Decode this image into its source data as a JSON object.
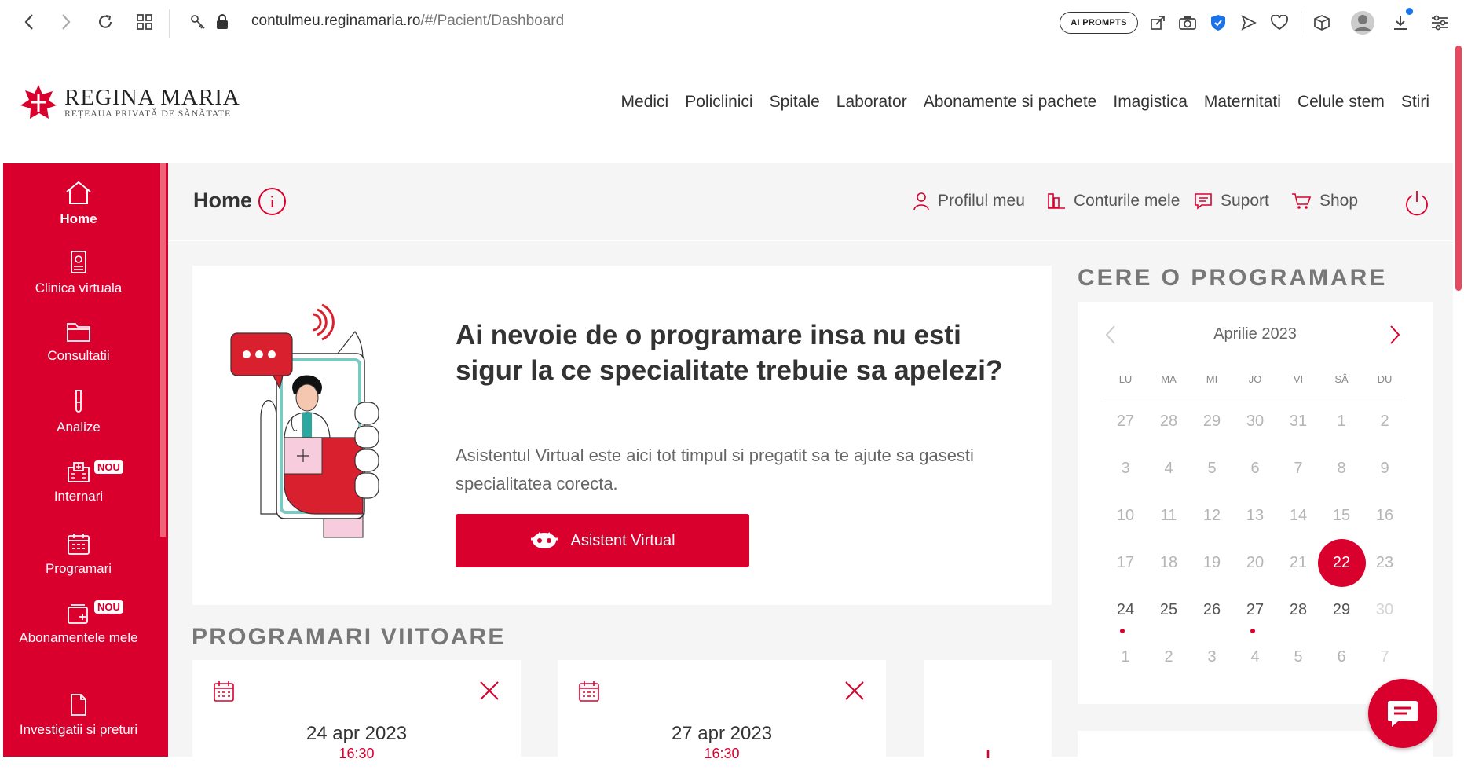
{
  "browser": {
    "url_domain": "contulmeu.reginamaria.ro",
    "url_path": "/#/Pacient/Dashboard",
    "ai_prompts_label": "AI PROMPTS"
  },
  "site": {
    "logo_name": "REGINA MARIA",
    "logo_tagline": "REȚEAUA PRIVATĂ DE SĂNĂTATE",
    "nav": [
      "Medici",
      "Policlinici",
      "Spitale",
      "Laborator",
      "Abonamente si pachete",
      "Imagistica",
      "Maternitati",
      "Celule stem",
      "Stiri"
    ]
  },
  "sidebar": {
    "items": [
      {
        "label": "Home",
        "bold": true
      },
      {
        "label": "Clinica virtuala"
      },
      {
        "label": "Consultatii"
      },
      {
        "label": "Analize"
      },
      {
        "label": "Internari",
        "badge": "NOU"
      },
      {
        "label": "Programari"
      },
      {
        "label": "Abonamentele mele",
        "badge": "NOU"
      },
      {
        "label": "Investigatii si preturi"
      }
    ]
  },
  "topbar": {
    "title": "Home",
    "info": "i",
    "links": [
      "Profilul meu",
      "Conturile mele",
      "Suport",
      "Shop"
    ]
  },
  "hero": {
    "title": "Ai nevoie de o programare insa nu esti sigur la ce specialitate trebuie sa apelezi?",
    "subtitle": "Asistentul Virtual este aici tot timpul si pregatit sa te ajute sa gasesti specialitatea corecta.",
    "button": "Asistent Virtual"
  },
  "appointments": {
    "title": "PROGRAMARI VIITOARE",
    "cards": [
      {
        "date": "24 apr 2023",
        "time": "16:30"
      },
      {
        "date": "27 apr 2023",
        "time": "16:30"
      }
    ]
  },
  "calendar": {
    "title": "CERE O PROGRAMARE",
    "month": "Aprilie 2023",
    "weekdays": [
      "LU",
      "MA",
      "MI",
      "JO",
      "VI",
      "SÂ",
      "DU"
    ],
    "weeks": [
      [
        "27",
        "28",
        "29",
        "30",
        "31",
        "1",
        "2"
      ],
      [
        "3",
        "4",
        "5",
        "6",
        "7",
        "8",
        "9"
      ],
      [
        "10",
        "11",
        "12",
        "13",
        "14",
        "15",
        "16"
      ],
      [
        "17",
        "18",
        "19",
        "20",
        "21",
        "22",
        "23"
      ],
      [
        "24",
        "25",
        "26",
        "27",
        "28",
        "29",
        "30"
      ],
      [
        "1",
        "2",
        "3",
        "4",
        "5",
        "6",
        "7"
      ]
    ],
    "today": "22",
    "colors": {
      "accent": "#d9002e",
      "muted": "#b5b5b5",
      "active": "#555555",
      "faint": "#d4d4d4"
    }
  }
}
